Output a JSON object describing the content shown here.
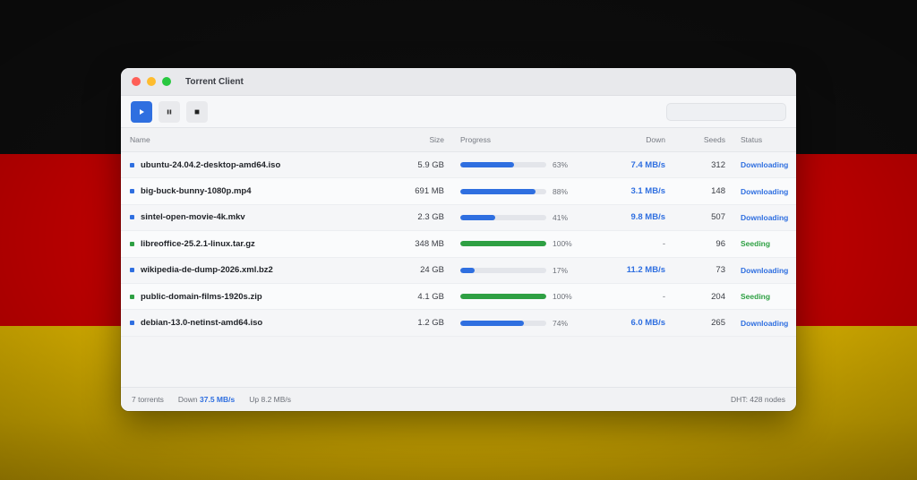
{
  "window": {
    "title": "Torrent Client"
  },
  "toolbar": {
    "buttons": [
      {
        "name": "play-button",
        "icon": "play-icon"
      },
      {
        "name": "pause-button",
        "icon": "pause-icon"
      },
      {
        "name": "stop-button",
        "icon": "stop-icon"
      }
    ],
    "search_placeholder": ""
  },
  "columns": {
    "name": "Name",
    "size": "Size",
    "progress": "Progress",
    "down": "Down",
    "seeds": "Seeds",
    "status": "Status"
  },
  "colors": {
    "accent": "#2f6fe0",
    "seeding": "#2ea043",
    "downloading": "#2f6fe0"
  },
  "torrents": [
    {
      "name": "ubuntu-24.04.2-desktop-amd64.iso",
      "size": "5.9 GB",
      "progress": 63,
      "progress_label": "63%",
      "down": "7.4 MB/s",
      "seeds": "312",
      "status": "Downloading",
      "state": "downloading"
    },
    {
      "name": "big-buck-bunny-1080p.mp4",
      "size": "691 MB",
      "progress": 88,
      "progress_label": "88%",
      "down": "3.1 MB/s",
      "seeds": "148",
      "status": "Downloading",
      "state": "downloading"
    },
    {
      "name": "sintel-open-movie-4k.mkv",
      "size": "2.3 GB",
      "progress": 41,
      "progress_label": "41%",
      "down": "9.8 MB/s",
      "seeds": "507",
      "status": "Downloading",
      "state": "downloading"
    },
    {
      "name": "libreoffice-25.2.1-linux.tar.gz",
      "size": "348 MB",
      "progress": 100,
      "progress_label": "100%",
      "down": "-",
      "seeds": "96",
      "status": "Seeding",
      "state": "seeding"
    },
    {
      "name": "wikipedia-de-dump-2026.xml.bz2",
      "size": "24 GB",
      "progress": 17,
      "progress_label": "17%",
      "down": "11.2 MB/s",
      "seeds": "73",
      "status": "Downloading",
      "state": "downloading"
    },
    {
      "name": "public-domain-films-1920s.zip",
      "size": "4.1 GB",
      "progress": 100,
      "progress_label": "100%",
      "down": "-",
      "seeds": "204",
      "status": "Seeding",
      "state": "seeding"
    },
    {
      "name": "debian-13.0-netinst-amd64.iso",
      "size": "1.2 GB",
      "progress": 74,
      "progress_label": "74%",
      "down": "6.0 MB/s",
      "seeds": "265",
      "status": "Downloading",
      "state": "downloading"
    }
  ],
  "statusbar": {
    "count": "7 torrents",
    "down_label": "Down",
    "down_value": "37.5 MB/s",
    "up_label": "Up",
    "up_value": "8.2 MB/s",
    "dht": "DHT: 428 nodes"
  }
}
